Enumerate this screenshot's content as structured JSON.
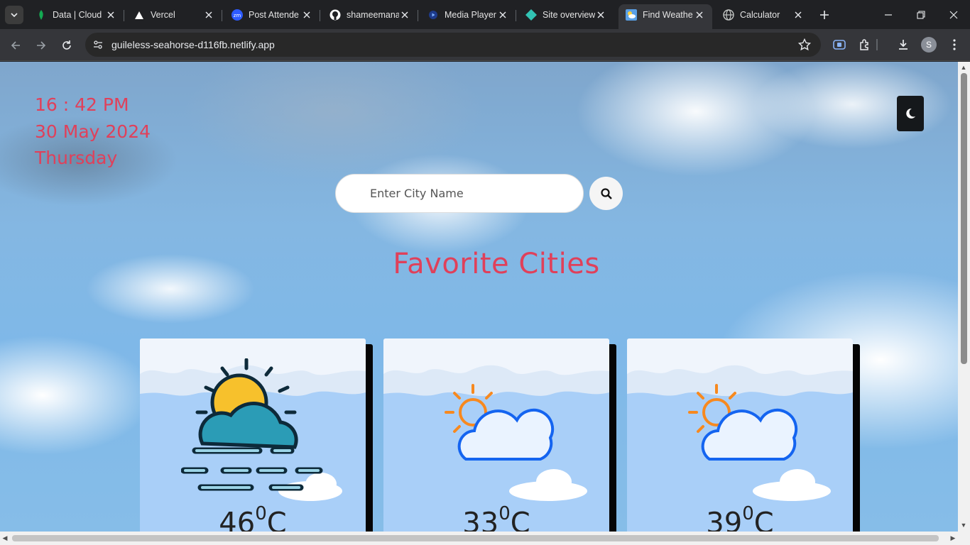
{
  "browser": {
    "tabs": [
      {
        "title": "Data | Cloud",
        "icon": "mongodb-leaf-icon"
      },
      {
        "title": "Vercel",
        "icon": "vercel-triangle-icon"
      },
      {
        "title": "Post Attende",
        "icon": "zoom-icon"
      },
      {
        "title": "shameemana",
        "icon": "github-icon"
      },
      {
        "title": "Media Player",
        "icon": "media-play-icon"
      },
      {
        "title": "Site overview",
        "icon": "netlify-icon"
      },
      {
        "title": "Find Weathe",
        "icon": "weather-icon"
      },
      {
        "title": "Calculator",
        "icon": "globe-icon"
      }
    ],
    "active_tab_index": 6,
    "url": "guileless-seahorse-d116fb.netlify.app",
    "profile_initial": "S"
  },
  "page": {
    "time": "16 : 42 PM",
    "date": "30 May 2024",
    "day": "Thursday",
    "search": {
      "placeholder": "Enter City Name"
    },
    "favorites_title": "Favorite Cities",
    "cities": [
      {
        "temp": "46",
        "unit": "C",
        "icon": "sun-cloud-fog-icon"
      },
      {
        "temp": "33",
        "unit": "C",
        "icon": "partly-cloudy-icon"
      },
      {
        "temp": "39",
        "unit": "C",
        "icon": "partly-cloudy-icon"
      }
    ]
  },
  "colors": {
    "accent": "#e0405a",
    "browser_bg": "#202124",
    "toolbar_bg": "#35363a"
  }
}
